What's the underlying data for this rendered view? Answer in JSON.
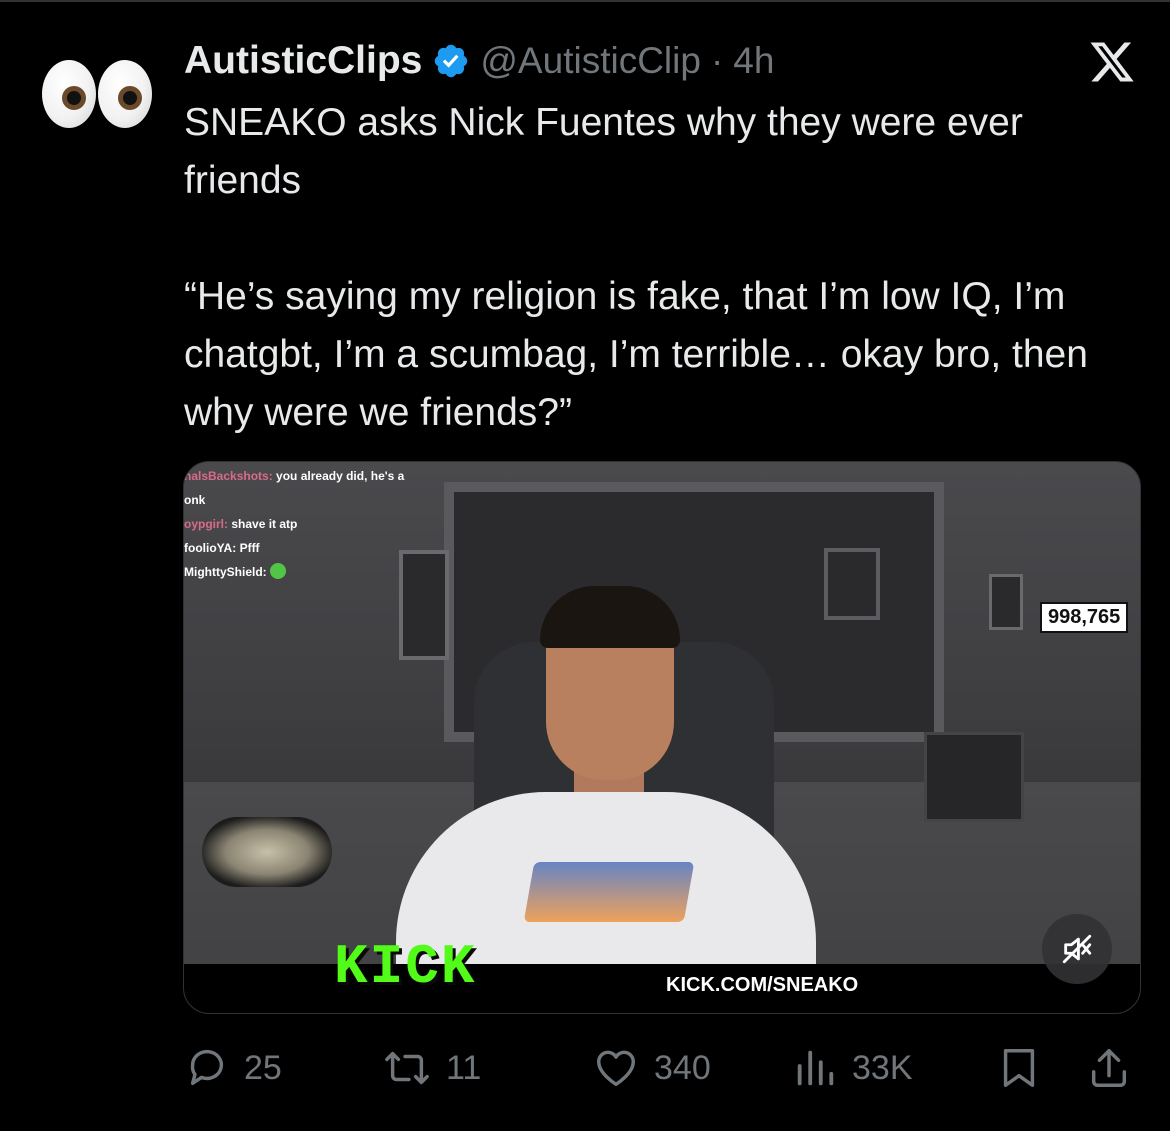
{
  "tweet": {
    "author": {
      "display_name": "AutisticClips",
      "handle": "@AutisticClip",
      "separator": "·",
      "time": "4h",
      "avatar_icon": "eyes-emoji-icon",
      "verified_color": "#1d9bf0"
    },
    "text": {
      "paragraph1": "SNEAKO asks Nick Fuentes why they were ever friends",
      "paragraph2": "“He’s saying my religion is fake, that I’m low IQ, I’m chatgbt, I’m a scumbag, I’m terrible… okay bro, then why were we friends?”"
    },
    "media": {
      "chat": [
        {
          "user": "nalsBackshots:",
          "message": "you already did, he's a"
        },
        {
          "user": "",
          "message": "onk"
        },
        {
          "user": "oypgirl:",
          "message": "shave it atp"
        },
        {
          "user": "foolioYA:",
          "message": "Pfff"
        },
        {
          "user": "MighttyShield:",
          "message": ""
        }
      ],
      "viewer_count": "998,765",
      "brand_logo": "KICK",
      "stream_url": "KICK.COM/SNEAKO",
      "brand_color": "#53fc18",
      "mute_icon": "muted-speaker-icon"
    },
    "stats": {
      "replies": "25",
      "reposts": "11",
      "likes": "340",
      "views": "33K"
    }
  },
  "icons": [
    "x-logo-icon",
    "verified-badge-icon",
    "reply-icon",
    "repost-icon",
    "like-icon",
    "views-icon",
    "bookmark-icon",
    "share-icon"
  ],
  "colors": {
    "background": "#000000",
    "text_primary": "#e7e9ea",
    "text_secondary": "#71767b"
  }
}
